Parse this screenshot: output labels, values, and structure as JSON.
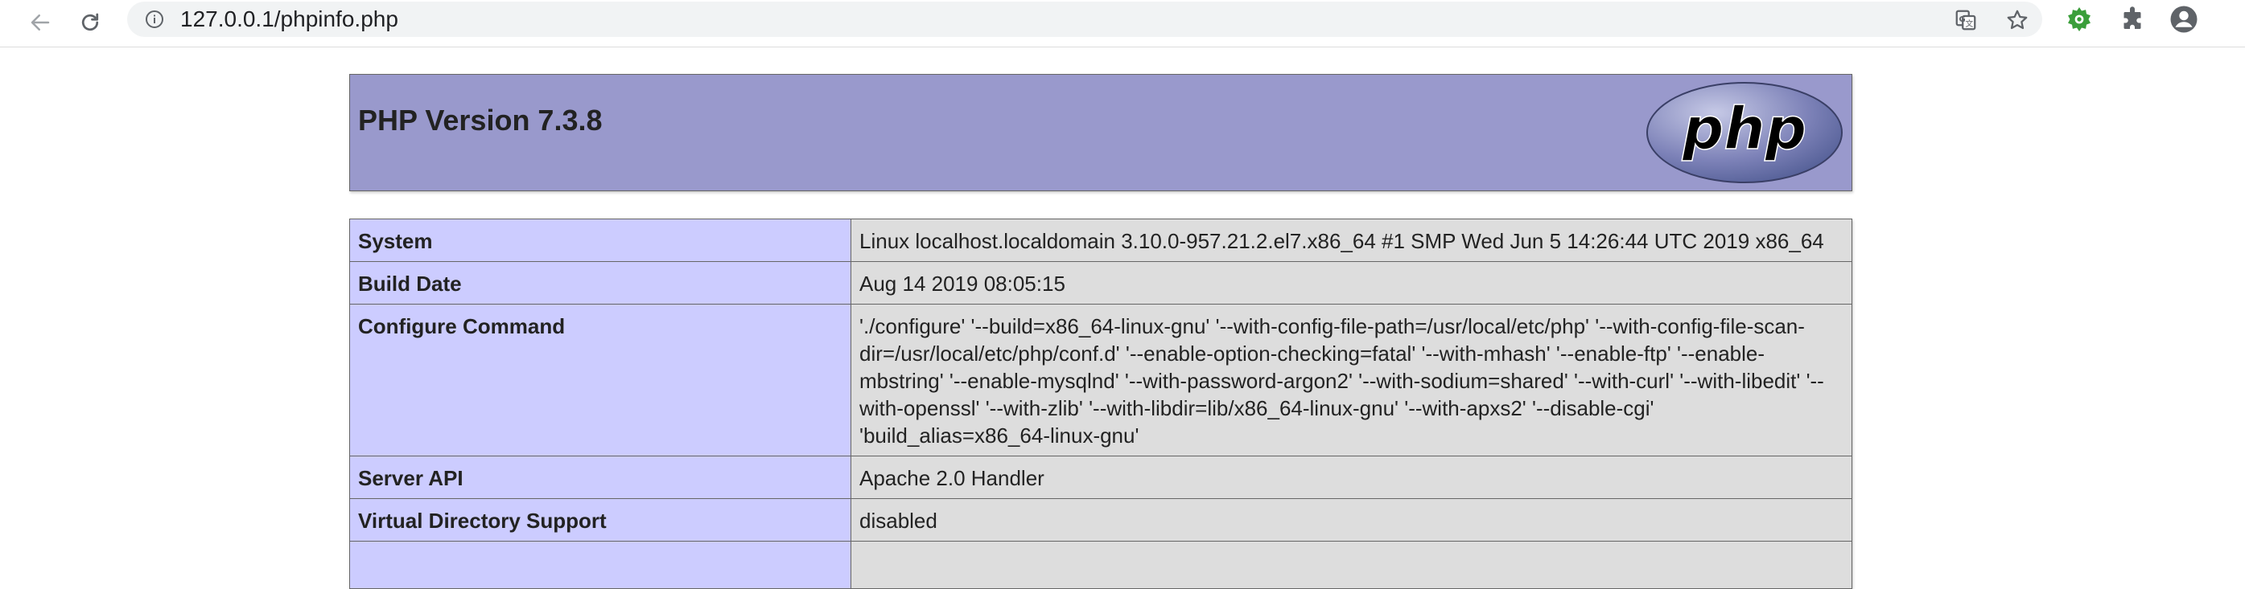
{
  "browser": {
    "url": "127.0.0.1/phpinfo.php"
  },
  "page": {
    "title": "PHP Version 7.3.8",
    "logo_text": "php",
    "rows": [
      {
        "key": "System",
        "value": "Linux localhost.localdomain 3.10.0-957.21.2.el7.x86_64 #1 SMP Wed Jun 5 14:26:44 UTC 2019 x86_64"
      },
      {
        "key": "Build Date",
        "value": "Aug 14 2019 08:05:15"
      },
      {
        "key": "Configure Command",
        "value": "'./configure' '--build=x86_64-linux-gnu' '--with-config-file-path=/usr/local/etc/php' '--with-config-file-scan-dir=/usr/local/etc/php/conf.d' '--enable-option-checking=fatal' '--with-mhash' '--enable-ftp' '--enable-mbstring' '--enable-mysqlnd' '--with-password-argon2' '--with-sodium=shared' '--with-curl' '--with-libedit' '--with-openssl' '--with-zlib' '--with-libdir=lib/x86_64-linux-gnu' '--with-apxs2' '--disable-cgi' 'build_alias=x86_64-linux-gnu'"
      },
      {
        "key": "Server API",
        "value": "Apache 2.0 Handler"
      },
      {
        "key": "Virtual Directory Support",
        "value": "disabled"
      },
      {
        "key": "",
        "value": ""
      }
    ]
  },
  "colors": {
    "header_bg": "#9999cc",
    "key_bg": "#ccccff",
    "value_bg": "#dddddd"
  },
  "icons": [
    "back-arrow-icon",
    "reload-icon",
    "info-icon",
    "translate-icon",
    "star-icon",
    "extension-gear-icon",
    "puzzle-icon",
    "profile-icon"
  ]
}
